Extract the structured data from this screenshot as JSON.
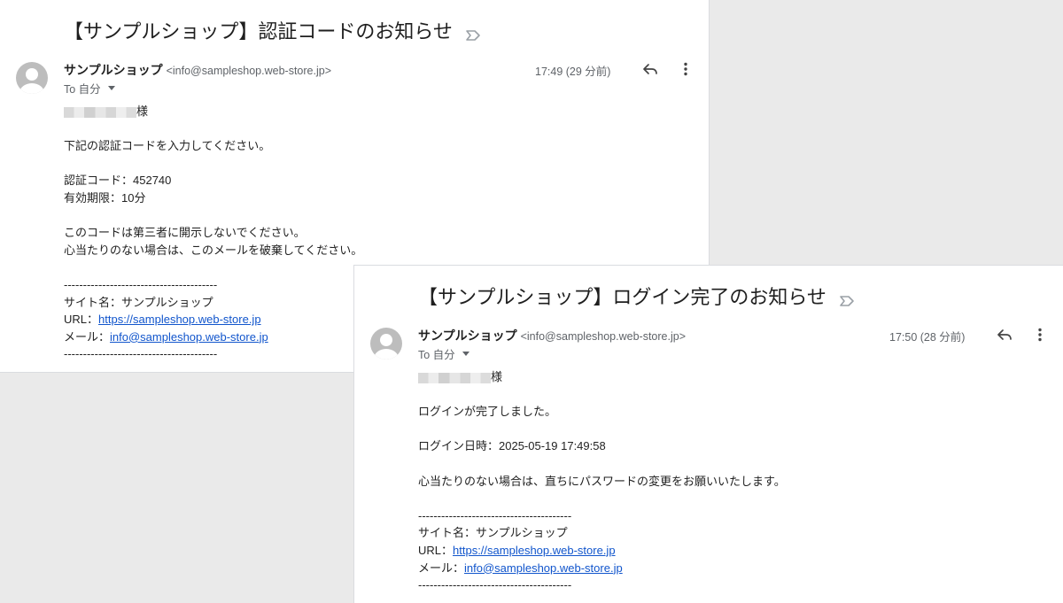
{
  "emails": [
    {
      "subject": "【サンプルショップ】認証コードのお知らせ",
      "sender_name": "サンプルショップ",
      "sender_address": "<info@sampleshop.web-store.jp>",
      "to_label": "To 自分",
      "time": "17:49 (29 分前)",
      "salutation": "様",
      "body": {
        "line1": "下記の認証コードを入力してください。",
        "code_line": "認証コード：452740",
        "expiry_line": "有効期限：10分",
        "warn1": "このコードは第三者に開示しないでください。",
        "warn2": "心当たりのない場合は、このメールを破棄してください。",
        "divider": "----------------------------------------",
        "site_name_line": "サイト名：サンプルショップ",
        "url_label": "URL：",
        "url": "https://sampleshop.web-store.jp",
        "mail_label": "メール：",
        "mail": "info@sampleshop.web-store.jp"
      }
    },
    {
      "subject": "【サンプルショップ】ログイン完了のお知らせ",
      "sender_name": "サンプルショップ",
      "sender_address": "<info@sampleshop.web-store.jp>",
      "to_label": "To 自分",
      "time": "17:50 (28 分前)",
      "salutation": "様",
      "body": {
        "line1": "ログインが完了しました。",
        "login_time_line": "ログイン日時：2025-05-19 17:49:58",
        "warn": "心当たりのない場合は、直ちにパスワードの変更をお願いいたします。",
        "divider": "----------------------------------------",
        "site_name_line": "サイト名：サンプルショップ",
        "url_label": "URL：",
        "url": "https://sampleshop.web-store.jp",
        "mail_label": "メール：",
        "mail": "info@sampleshop.web-store.jp"
      }
    }
  ],
  "icons": [
    "label-important-icon",
    "avatar-icon",
    "reply-icon",
    "more-vert-icon",
    "chevron-down-icon"
  ]
}
